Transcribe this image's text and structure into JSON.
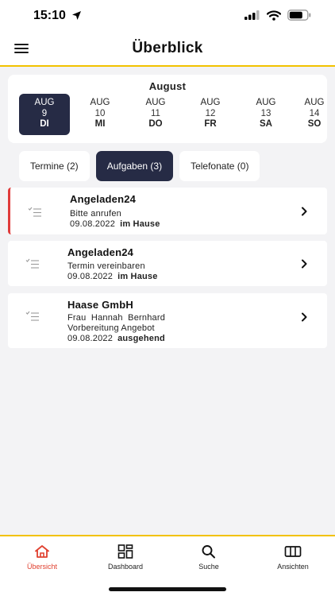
{
  "status_bar": {
    "time": "15:10"
  },
  "header": {
    "title": "Überblick"
  },
  "calendar": {
    "month": "August",
    "days": [
      {
        "month": "AUG",
        "day": "9",
        "weekday": "DI",
        "selected": true
      },
      {
        "month": "AUG",
        "day": "10",
        "weekday": "MI",
        "selected": false
      },
      {
        "month": "AUG",
        "day": "11",
        "weekday": "DO",
        "selected": false
      },
      {
        "month": "AUG",
        "day": "12",
        "weekday": "FR",
        "selected": false
      },
      {
        "month": "AUG",
        "day": "13",
        "weekday": "SA",
        "selected": false
      },
      {
        "month": "AUG",
        "day": "14",
        "weekday": "SO",
        "selected": false
      }
    ]
  },
  "tabs": [
    {
      "label": "Termine (2)",
      "active": false
    },
    {
      "label": "Aufgaben (3)",
      "active": true
    },
    {
      "label": "Telefonate (0)",
      "active": false
    }
  ],
  "tasks": [
    {
      "title": "Angeladen24",
      "contact": "",
      "subject": "Bitte anrufen",
      "date": "09.08.2022",
      "direction": "im Hause",
      "flagged": true
    },
    {
      "title": "Angeladen24",
      "contact": "",
      "subject": "Termin vereinbaren",
      "date": "09.08.2022",
      "direction": "im Hause",
      "flagged": false
    },
    {
      "title": "Haase GmbH",
      "contact": "Frau  Hannah  Bernhard",
      "subject": "Vorbereitung Angebot",
      "date": "09.08.2022",
      "direction": "ausgehend",
      "flagged": false
    }
  ],
  "bottom_nav": [
    {
      "label": "Übersicht",
      "icon": "home-icon",
      "active": true
    },
    {
      "label": "Dashboard",
      "icon": "dashboard-icon",
      "active": false
    },
    {
      "label": "Suche",
      "icon": "search-icon",
      "active": false
    },
    {
      "label": "Ansichten",
      "icon": "views-icon",
      "active": false
    }
  ],
  "colors": {
    "accent_yellow": "#f2c200",
    "selected_navy": "#262b45",
    "flag_red": "#e03b3b",
    "active_nav_red": "#e0402f"
  }
}
